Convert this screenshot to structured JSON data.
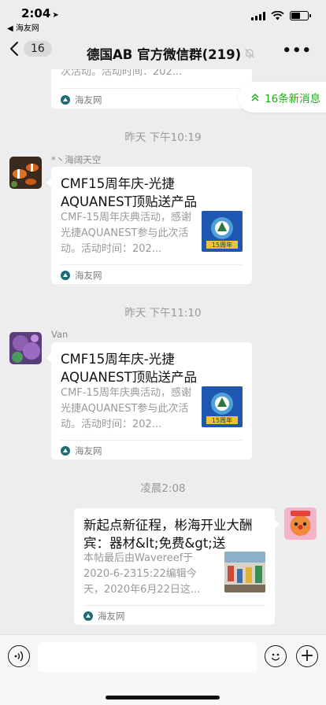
{
  "status_bar": {
    "time": "2:04",
    "location_arrow": "➤",
    "back_app": "◀ 海友网",
    "signal_icon": "signal-icon",
    "wifi_icon": "wifi-icon",
    "battery_icon": "battery-icon"
  },
  "nav": {
    "unread_badge": "16",
    "title": "德国AB 官方微信群(219)",
    "mute_icon": "bell-off-icon",
    "more_icon": "more-icon"
  },
  "new_messages": {
    "label": "16条新消息",
    "icon": "double-chevron-up-icon"
  },
  "messages": [
    {
      "type": "link_card_partial",
      "side": "left",
      "desc_visible": "次活动。活动时间：202...",
      "source": "海友网"
    },
    {
      "type": "timestamp",
      "text": "昨天 下午10:19"
    },
    {
      "type": "link_card",
      "side": "left",
      "sender": "*丶海阔天空",
      "title": "CMF15周年庆-光捷AQUANEST顶贴送产品",
      "desc": "CMF-15周年庆典活动，感谢光捷AQUANEST参与此次活动。活动时间：202...",
      "source": "海友网",
      "thumb_text": "15周年"
    },
    {
      "type": "timestamp",
      "text": "昨天 下午11:10"
    },
    {
      "type": "link_card",
      "side": "left",
      "sender": "Van",
      "title": "CMF15周年庆-光捷AQUANEST顶贴送产品",
      "desc": "CMF-15周年庆典活动，感谢光捷AQUANEST参与此次活动。活动时间：202...",
      "source": "海友网",
      "thumb_text": "15周年"
    },
    {
      "type": "timestamp",
      "text": "凌晨2:08"
    },
    {
      "type": "link_card",
      "side": "right",
      "title": "新起点新征程，彬海开业大酬宾：器材&lt;免费&gt;送",
      "desc": "本帖最后由Wavereef于2020-6-2315:22编辑今天，2020年6月22日这...",
      "source": "海友网"
    }
  ],
  "input_bar": {
    "voice_icon": "voice-icon",
    "emoji_icon": "emoji-icon",
    "add_icon": "plus-icon",
    "add_glyph": "+"
  },
  "colors": {
    "background": "#ededed",
    "card": "#ffffff",
    "accent_green": "#1aad19",
    "muted_text": "#999999"
  }
}
